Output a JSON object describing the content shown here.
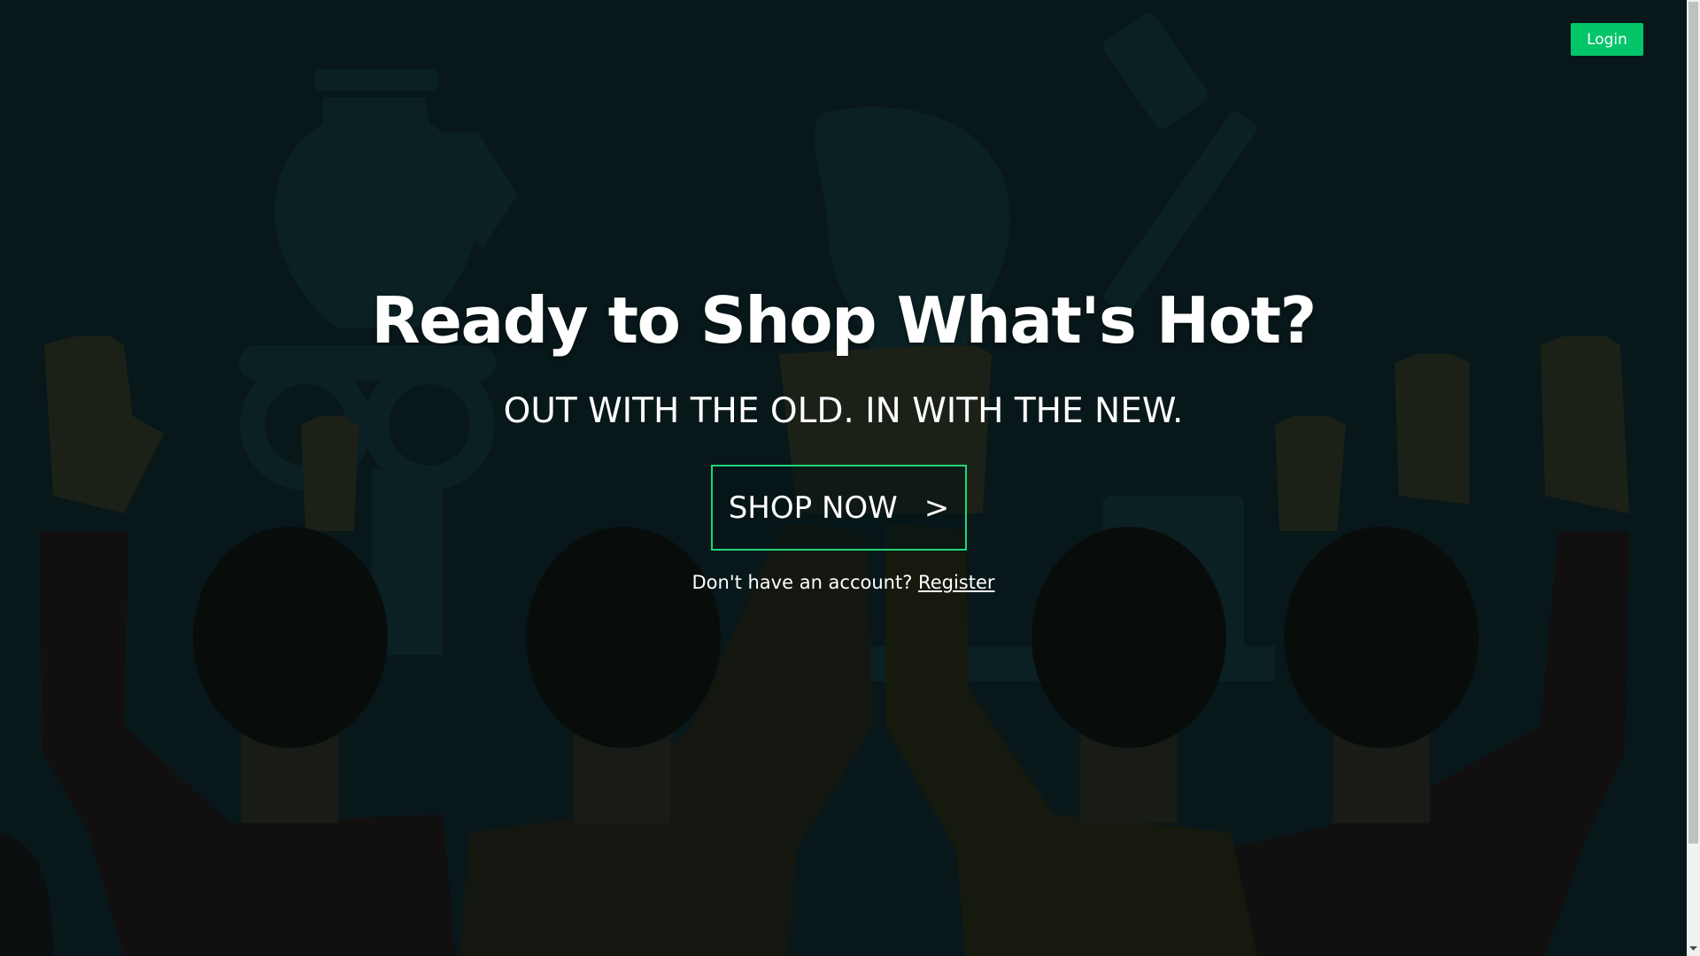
{
  "header": {
    "login_label": "Login"
  },
  "hero": {
    "title": "Ready to Shop What's Hot?",
    "subtitle": "OUT WITH THE OLD. IN WITH THE NEW.",
    "cta_label": "SHOP NOW",
    "cta_arrow": ">",
    "account_prompt": "Don't have an account?",
    "register_label": "Register"
  },
  "colors": {
    "accent": "#03c56a",
    "cta_border": "#1ed67a",
    "background": "#0a1a1c",
    "text": "#ffffff"
  },
  "icons": {
    "scroll_down": "scroll-down-arrow-icon"
  }
}
